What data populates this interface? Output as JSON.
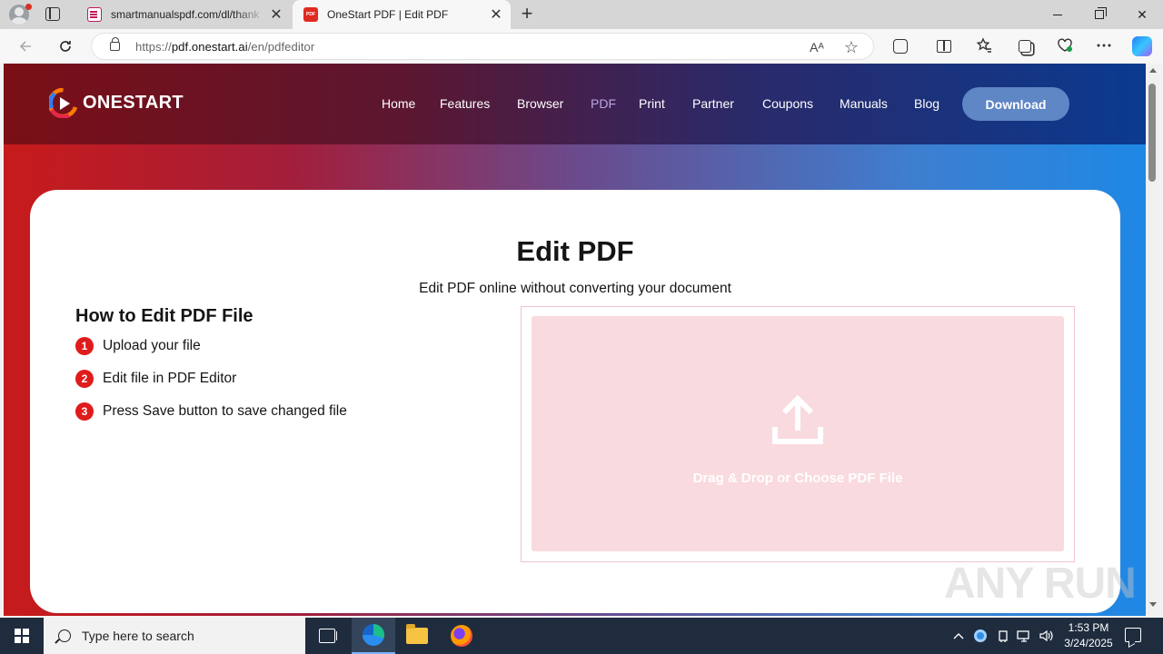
{
  "browser": {
    "tabs": [
      {
        "title": "smartmanualspdf.com/dl/thank",
        "favicon": "document-favicon-icon",
        "active": false
      },
      {
        "title": "OneStart PDF | Edit PDF",
        "favicon": "pdf-favicon-icon",
        "favicon_text": "PDF",
        "active": true
      }
    ],
    "new_tab_glyph": "+",
    "close_glyph": "✕",
    "url_scheme": "https://",
    "url_host": "pdf.onestart.ai",
    "url_path": "/en/pdfeditor",
    "read_aloud_glyph": "Aᴬ",
    "favorite_glyph": "☆"
  },
  "site": {
    "logo_text": "ONESTART",
    "nav": [
      "Home",
      "Features",
      "Browser",
      "PDF",
      "Print",
      "Partner",
      "Coupons",
      "Manuals",
      "Blog"
    ],
    "nav_active": "PDF",
    "download_label": "Download",
    "brand_colors": {
      "primary_red": "#e01b1b",
      "header_dark": "#5c1630",
      "header_blue": "#0b3a8f",
      "drop_zone": "#f9dadf"
    }
  },
  "main": {
    "title": "Edit PDF",
    "subtitle": "Edit PDF online without converting your document",
    "howto_title": "How to Edit PDF File",
    "steps": [
      {
        "num": "1",
        "text": "Upload your file"
      },
      {
        "num": "2",
        "text": "Edit file in PDF Editor"
      },
      {
        "num": "3",
        "text": "Press Save button to save changed file"
      }
    ],
    "drop_text": "Drag & Drop or Choose PDF File"
  },
  "watermark": "ANY RUN",
  "taskbar": {
    "search_placeholder": "Type here to search",
    "time": "1:53 PM",
    "date": "3/24/2025"
  }
}
